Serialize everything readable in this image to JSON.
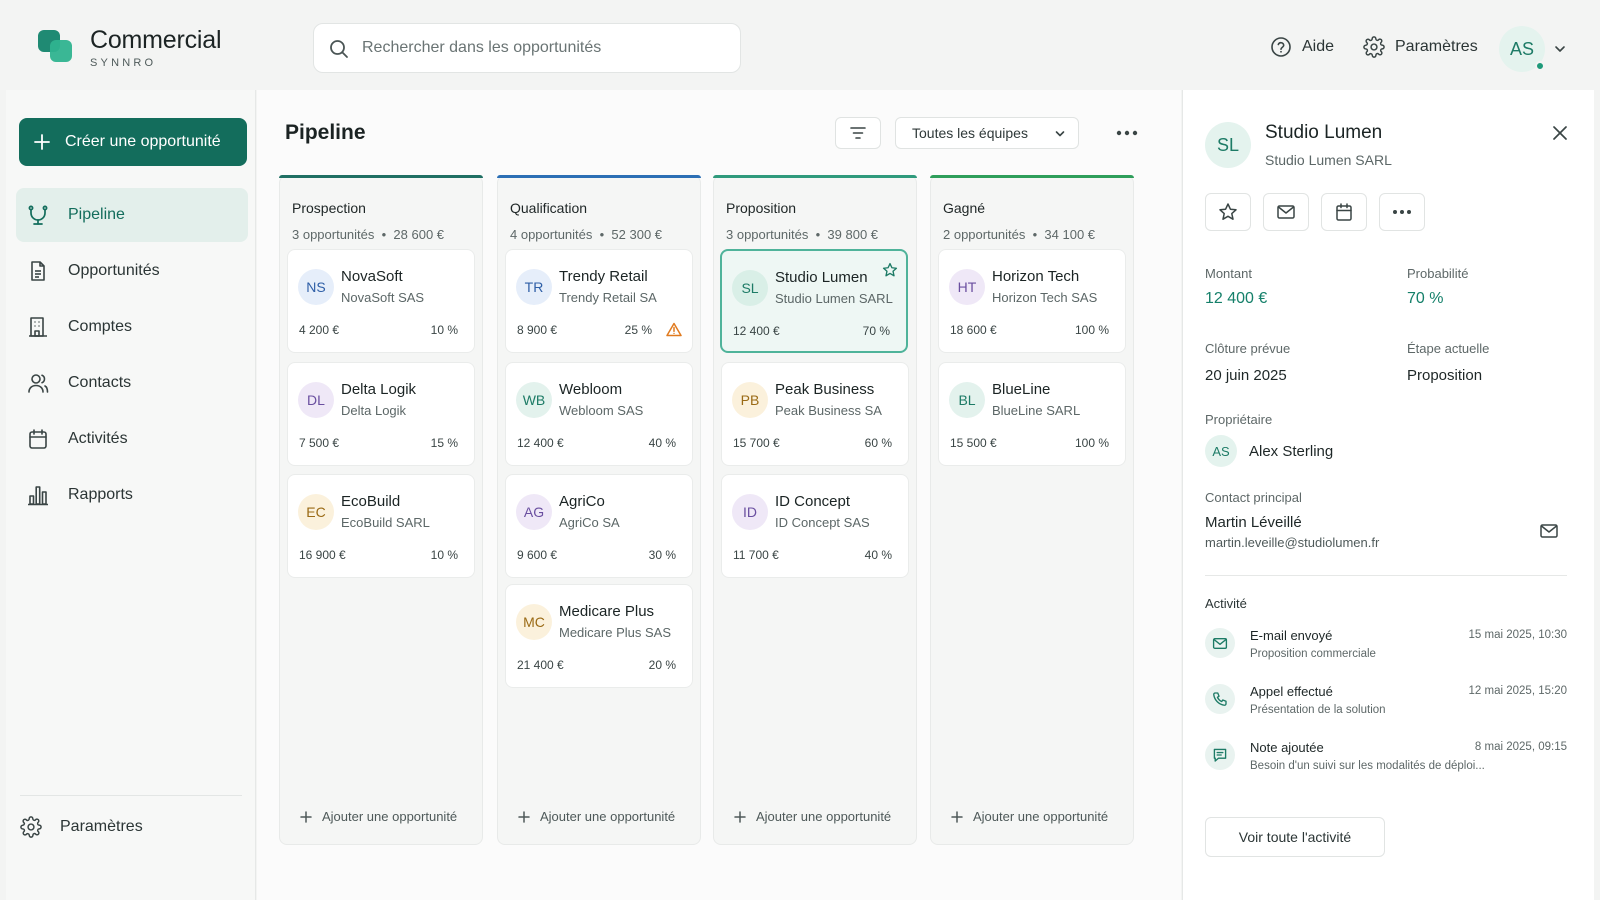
{
  "brand": {
    "name": "Commercial",
    "sub": "SYNNRO",
    "color_primary": "#136d5c",
    "color_accent": "#2fb38f"
  },
  "search": {
    "placeholder": "Rechercher dans les opportunités",
    "value": ""
  },
  "topnav": {
    "help": "Aide",
    "settings": "Paramètres",
    "user_initials": "AS"
  },
  "sidebar": {
    "create_label": "Créer une opportunité",
    "items": [
      {
        "label": "Pipeline",
        "icon": "pipeline-icon",
        "active": true
      },
      {
        "label": "Opportunités",
        "icon": "document-icon"
      },
      {
        "label": "Comptes",
        "icon": "building-icon"
      },
      {
        "label": "Contacts",
        "icon": "users-icon"
      },
      {
        "label": "Activités",
        "icon": "calendar-icon"
      },
      {
        "label": "Rapports",
        "icon": "bar-chart-icon"
      }
    ],
    "settings_label": "Paramètres"
  },
  "main": {
    "title": "Pipeline",
    "team_filter": "Toutes les équipes",
    "add_label": "Ajouter une opportunité",
    "columns": [
      {
        "title": "Prospection",
        "count": "3 opportunités",
        "total": "28 600 €",
        "color": "#1f6f63",
        "cards": [
          {
            "initials": "NS",
            "name": "NovaSoft",
            "company": "NovaSoft SAS",
            "amount": "4 200 €",
            "prob": "10 %",
            "av_bg": "#e6eefa",
            "av_fg": "#2f5fa7"
          },
          {
            "initials": "DL",
            "name": "Delta Logik",
            "company": "Delta Logik",
            "amount": "7 500 €",
            "prob": "15 %",
            "av_bg": "#efe8f7",
            "av_fg": "#6a4fa0"
          },
          {
            "initials": "EC",
            "name": "EcoBuild",
            "company": "EcoBuild SARL",
            "amount": "16 900 €",
            "prob": "10 %",
            "av_bg": "#fbf1dc",
            "av_fg": "#9a6a15"
          }
        ]
      },
      {
        "title": "Qualification",
        "count": "4 opportunités",
        "total": "52 300 €",
        "color": "#2c6fb5",
        "cards": [
          {
            "initials": "TR",
            "name": "Trendy Retail",
            "company": "Trendy Retail SA",
            "amount": "8 900 €",
            "prob": "25 %",
            "warning": true,
            "av_bg": "#e6eefa",
            "av_fg": "#2f5fa7"
          },
          {
            "initials": "WB",
            "name": "Webloom",
            "company": "Webloom SAS",
            "amount": "12 400 €",
            "prob": "40 %",
            "av_bg": "#e3f2ed",
            "av_fg": "#1d7b66"
          },
          {
            "initials": "AG",
            "name": "AgriCo",
            "company": "AgriCo SA",
            "amount": "9 600 €",
            "prob": "30 %",
            "av_bg": "#efe8f7",
            "av_fg": "#6a4fa0"
          },
          {
            "initials": "MC",
            "name": "Medicare Plus",
            "company": "Medicare Plus SAS",
            "amount": "21 400 €",
            "prob": "20 %",
            "av_bg": "#fbf1dc",
            "av_fg": "#9a6a15"
          }
        ]
      },
      {
        "title": "Proposition",
        "count": "3 opportunités",
        "total": "39 800 €",
        "color": "#2f9a7c",
        "cards": [
          {
            "initials": "SL",
            "name": "Studio Lumen",
            "company": "Studio Lumen SARL",
            "amount": "12 400 €",
            "prob": "70 %",
            "selected": true,
            "starred": true,
            "av_bg": "#d9efe7",
            "av_fg": "#1d7b66"
          },
          {
            "initials": "PB",
            "name": "Peak Business",
            "company": "Peak Business SA",
            "amount": "15 700 €",
            "prob": "60 %",
            "av_bg": "#fbf1dc",
            "av_fg": "#9a6a15"
          },
          {
            "initials": "ID",
            "name": "ID Concept",
            "company": "ID Concept SAS",
            "amount": "11 700 €",
            "prob": "40 %",
            "av_bg": "#efe8f7",
            "av_fg": "#6a4fa0"
          }
        ]
      },
      {
        "title": "Gagné",
        "count": "2 opportunités",
        "total": "34 100 €",
        "color": "#2e9e5a",
        "cards": [
          {
            "initials": "HT",
            "name": "Horizon Tech",
            "company": "Horizon Tech SAS",
            "amount": "18 600 €",
            "prob": "100 %",
            "av_bg": "#efe8f7",
            "av_fg": "#6a4fa0"
          },
          {
            "initials": "BL",
            "name": "BlueLine",
            "company": "BlueLine SARL",
            "amount": "15 500 €",
            "prob": "100 %",
            "av_bg": "#e3f2ed",
            "av_fg": "#1d7b66"
          }
        ]
      }
    ]
  },
  "panel": {
    "initials": "SL",
    "name": "Studio Lumen",
    "company": "Studio Lumen SARL",
    "fields": {
      "amount_label": "Montant",
      "amount": "12 400 €",
      "prob_label": "Probabilité",
      "prob": "70 %",
      "close_label": "Clôture prévue",
      "close": "20 juin 2025",
      "stage_label": "Étape actuelle",
      "stage": "Proposition",
      "owner_label": "Propriétaire",
      "owner_initials": "AS",
      "owner": "Alex Sterling",
      "contact_label": "Contact principal",
      "contact_name": "Martin Léveillé",
      "contact_email": "martin.leveille@studiolumen.fr"
    },
    "activity_title": "Activité",
    "activities": [
      {
        "icon": "mail-icon",
        "title": "E-mail envoyé",
        "desc": "Proposition commerciale",
        "time": "15 mai 2025, 10:30"
      },
      {
        "icon": "phone-icon",
        "title": "Appel effectué",
        "desc": "Présentation de la solution",
        "time": "12 mai 2025, 15:20"
      },
      {
        "icon": "note-icon",
        "title": "Note ajoutée",
        "desc": "Besoin d'un suivi sur les modalités de déploi...",
        "time": "8 mai 2025, 09:15"
      }
    ],
    "all_activity_label": "Voir toute l'activité"
  }
}
